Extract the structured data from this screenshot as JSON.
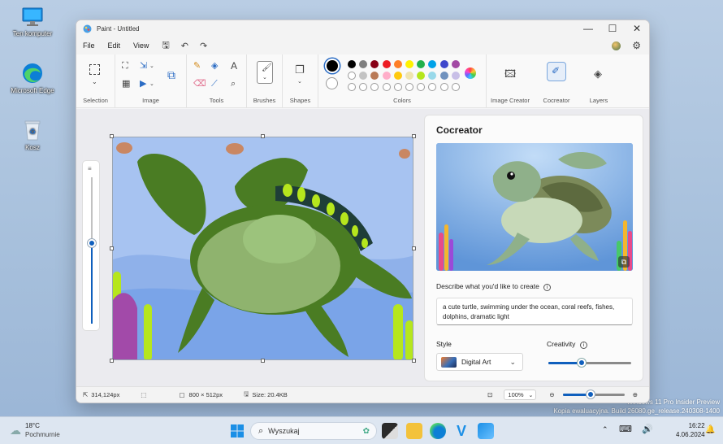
{
  "desktop": {
    "icons": [
      {
        "label": "Ten komputer",
        "icon": "monitor-icon"
      },
      {
        "label": "Microsoft Edge",
        "icon": "edge-icon"
      },
      {
        "label": "Kosz",
        "icon": "recycle-bin-icon"
      }
    ],
    "watermark_line1": "Windows 11 Pro Insider Preview",
    "watermark_line2": "Kopia ewaluacyjna. Build 26080.ge_release.240308-1400"
  },
  "window": {
    "title": "Paint - Untitled",
    "menu": [
      "File",
      "Edit",
      "View"
    ],
    "controls": {
      "minimize": "—",
      "maximize": "☐",
      "close": "✕"
    }
  },
  "ribbon": {
    "groups": {
      "selection": "Selection",
      "image": "Image",
      "tools": "Tools",
      "brushes": "Brushes",
      "shapes": "Shapes",
      "colors": "Colors",
      "image_creator": "Image Creator",
      "cocreator": "Cocreator",
      "layers": "Layers"
    },
    "colors": {
      "primary": "#000000",
      "secondary": "#ffffff",
      "palette_row1": [
        "#000000",
        "#7f7f7f",
        "#880015",
        "#ed1c24",
        "#ff7f27",
        "#fff200",
        "#22b14c",
        "#00a2e8",
        "#3f48cc",
        "#a349a4"
      ],
      "palette_row2": [
        "#ffffff",
        "#c3c3c3",
        "#b97a57",
        "#ffaec9",
        "#ffc90e",
        "#efe4b0",
        "#b5e61d",
        "#99d9ea",
        "#7092be",
        "#c8bfe7"
      ],
      "palette_row3_empty": 10
    }
  },
  "cocreator": {
    "title": "Cocreator",
    "describe_label": "Describe what you'd like to create",
    "prompt": "a cute turtle, swimming under the ocean, coral reefs, fishes, dolphins, dramatic light",
    "style_label": "Style",
    "style_value": "Digital Art",
    "creativity_label": "Creativity",
    "creativity_level": 0.4
  },
  "status": {
    "cursor": "314,124px",
    "dimensions": "800 × 512px",
    "size": "Size: 20.4KB",
    "zoom": "100%",
    "zoom_level": 0.45
  },
  "taskbar": {
    "weather_temp": "18°C",
    "weather_desc": "Pochmurnie",
    "search_placeholder": "Wyszukaj",
    "time": "16:22",
    "date": "4.06.2024"
  }
}
